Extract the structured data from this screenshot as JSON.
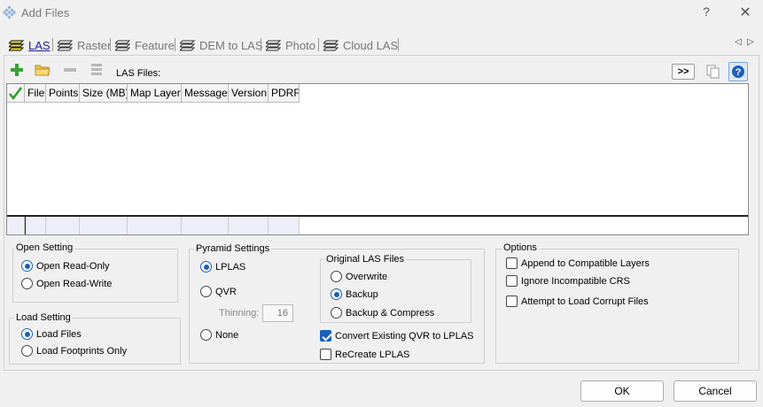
{
  "window": {
    "title": "Add Files",
    "help_label": "?",
    "close_label": "✕"
  },
  "tabs": [
    {
      "label": "LAS"
    },
    {
      "label": "Raster"
    },
    {
      "label": "Feature"
    },
    {
      "label": "DEM to LAS"
    },
    {
      "label": "Photo"
    },
    {
      "label": "Cloud LAS"
    }
  ],
  "tab_scroll": {
    "left": "◁",
    "right": "▷"
  },
  "toolbar": {
    "files_label": "LAS Files:",
    "more_label": ">>"
  },
  "grid": {
    "columns": [
      "File",
      "Points",
      "Size (MB)",
      "Map Layer",
      "Message",
      "Version",
      "PDRF"
    ]
  },
  "open_setting": {
    "title": "Open Setting",
    "options": [
      "Open Read-Only",
      "Open Read-Write"
    ],
    "selected": "Open Read-Only"
  },
  "load_setting": {
    "title": "Load Setting",
    "options": [
      "Load Files",
      "Load Footprints Only"
    ],
    "selected": "Load Files"
  },
  "pyramid": {
    "title": "Pyramid Settings",
    "options": [
      "LPLAS",
      "QVR",
      "None"
    ],
    "selected": "LPLAS",
    "thinning_label": "Thinning:",
    "thinning_value": "16",
    "original": {
      "title": "Original LAS Files",
      "options": [
        "Overwrite",
        "Backup",
        "Backup & Compress"
      ],
      "selected": "Backup"
    },
    "convert_label": "Convert Existing QVR to LPLAS",
    "convert_checked": true,
    "recreate_label": "ReCreate LPLAS",
    "recreate_checked": false
  },
  "options": {
    "title": "Options",
    "items": [
      {
        "label": "Append to Compatible Layers",
        "checked": false
      },
      {
        "label": "Ignore Incompatible CRS",
        "checked": false
      },
      {
        "label": "Attempt to Load Corrupt Files",
        "checked": false
      }
    ]
  },
  "buttons": {
    "ok": "OK",
    "cancel": "Cancel"
  },
  "colors": {
    "accent": "#1c5fb5",
    "active_tab": "#1c1c96",
    "grid_footer": "#eeeef8"
  }
}
